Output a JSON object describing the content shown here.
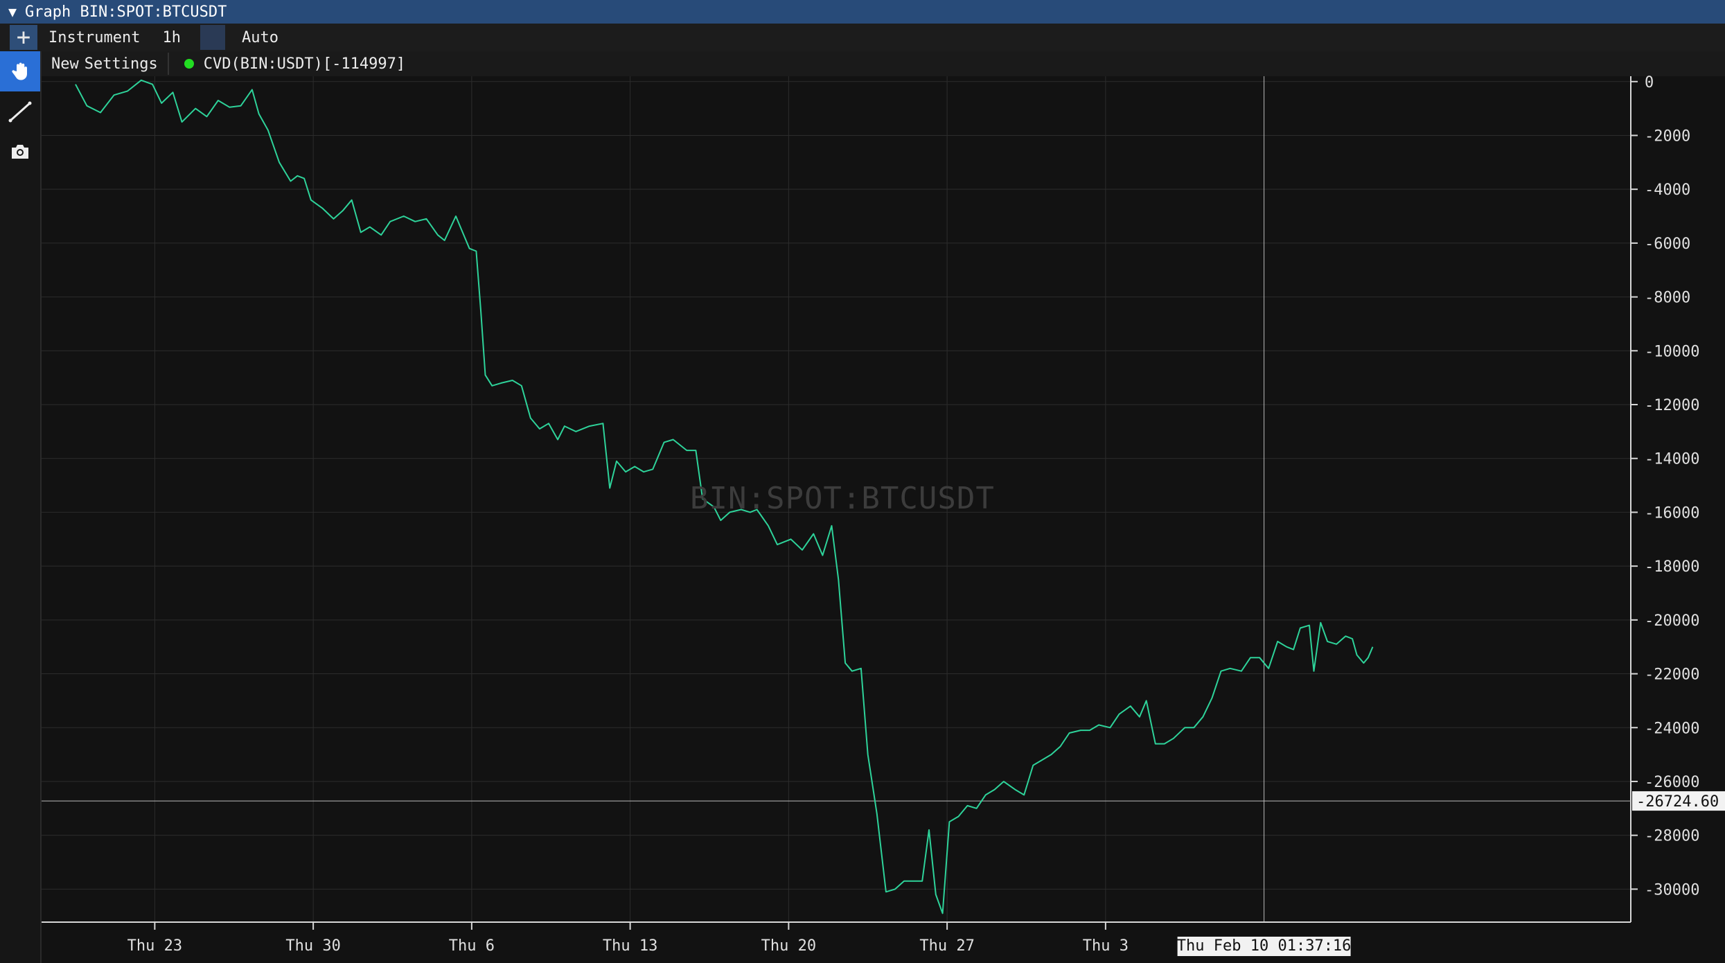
{
  "title_bar": {
    "label": "Graph BIN:SPOT:BTCUSDT",
    "collapse_icon": "triangle-down-icon"
  },
  "toolbar": {
    "add_icon": "plus-icon",
    "instrument_label": "Instrument",
    "timeframe_label": "1h",
    "auto_label": "Auto"
  },
  "subtoolbar": {
    "new_label": "New",
    "settings_label": "Settings",
    "indicator_status_color": "#22dd22",
    "indicator_label": "CVD(BIN:USDT)[-114997]"
  },
  "left_tools": [
    "hand-icon",
    "line-draw-icon",
    "camera-icon"
  ],
  "chart_data": {
    "type": "line",
    "watermark": "BIN:SPOT:BTCUSDT",
    "line_color": "#2ed39a",
    "x_unit": "days after Thu 23",
    "x_range": [
      -5.0,
      65.2
    ],
    "x_ticks": [
      {
        "x": 0,
        "label": "Thu 23"
      },
      {
        "x": 7,
        "label": "Thu 30"
      },
      {
        "x": 14,
        "label": "Thu 6"
      },
      {
        "x": 21,
        "label": "Thu 13"
      },
      {
        "x": 28,
        "label": "Thu 20"
      },
      {
        "x": 35,
        "label": "Thu 27"
      },
      {
        "x": 42,
        "label": "Thu 3"
      }
    ],
    "crosshair": {
      "x": 49.0,
      "x_label": "Thu Feb 10 01:37:16",
      "y": -26724.6,
      "y_label": "-26724.60"
    },
    "ylim": [
      -31200,
      200
    ],
    "y_ticks": [
      0,
      -2000,
      -4000,
      -6000,
      -8000,
      -10000,
      -12000,
      -14000,
      -16000,
      -18000,
      -20000,
      -22000,
      -24000,
      -26000,
      -28000,
      -30000
    ],
    "grid": true,
    "series": [
      {
        "points": [
          [
            -3.5,
            -100
          ],
          [
            -3.0,
            -900
          ],
          [
            -2.4,
            -1150
          ],
          [
            -1.8,
            -500
          ],
          [
            -1.2,
            -350
          ],
          [
            -0.6,
            50
          ],
          [
            -0.1,
            -100
          ],
          [
            0.3,
            -800
          ],
          [
            0.8,
            -400
          ],
          [
            1.2,
            -1500
          ],
          [
            1.8,
            -1000
          ],
          [
            2.3,
            -1300
          ],
          [
            2.8,
            -700
          ],
          [
            3.3,
            -950
          ],
          [
            3.8,
            -900
          ],
          [
            4.3,
            -300
          ],
          [
            4.6,
            -1200
          ],
          [
            5.0,
            -1800
          ],
          [
            5.5,
            -3000
          ],
          [
            6.0,
            -3700
          ],
          [
            6.3,
            -3500
          ],
          [
            6.6,
            -3600
          ],
          [
            6.9,
            -4400
          ],
          [
            7.4,
            -4700
          ],
          [
            7.9,
            -5100
          ],
          [
            8.3,
            -4800
          ],
          [
            8.7,
            -4400
          ],
          [
            9.1,
            -5600
          ],
          [
            9.5,
            -5400
          ],
          [
            10.0,
            -5700
          ],
          [
            10.4,
            -5200
          ],
          [
            11.0,
            -5000
          ],
          [
            11.5,
            -5200
          ],
          [
            12.0,
            -5100
          ],
          [
            12.5,
            -5700
          ],
          [
            12.8,
            -5900
          ],
          [
            13.3,
            -5000
          ],
          [
            13.6,
            -5600
          ],
          [
            13.9,
            -6200
          ],
          [
            14.2,
            -6300
          ],
          [
            14.4,
            -8500
          ],
          [
            14.6,
            -10900
          ],
          [
            14.9,
            -11300
          ],
          [
            15.3,
            -11200
          ],
          [
            15.8,
            -11100
          ],
          [
            16.2,
            -11300
          ],
          [
            16.6,
            -12500
          ],
          [
            17.0,
            -12900
          ],
          [
            17.4,
            -12700
          ],
          [
            17.8,
            -13300
          ],
          [
            18.1,
            -12800
          ],
          [
            18.6,
            -13000
          ],
          [
            19.2,
            -12800
          ],
          [
            19.8,
            -12700
          ],
          [
            20.1,
            -15100
          ],
          [
            20.4,
            -14100
          ],
          [
            20.8,
            -14500
          ],
          [
            21.2,
            -14300
          ],
          [
            21.6,
            -14500
          ],
          [
            22.0,
            -14400
          ],
          [
            22.5,
            -13400
          ],
          [
            22.9,
            -13300
          ],
          [
            23.5,
            -13700
          ],
          [
            23.9,
            -13700
          ],
          [
            24.2,
            -15500
          ],
          [
            24.7,
            -15800
          ],
          [
            25.0,
            -16300
          ],
          [
            25.4,
            -16000
          ],
          [
            25.9,
            -15900
          ],
          [
            26.3,
            -16000
          ],
          [
            26.6,
            -15900
          ],
          [
            27.1,
            -16500
          ],
          [
            27.5,
            -17200
          ],
          [
            28.1,
            -17000
          ],
          [
            28.6,
            -17400
          ],
          [
            29.1,
            -16800
          ],
          [
            29.5,
            -17600
          ],
          [
            29.9,
            -16500
          ],
          [
            30.2,
            -18500
          ],
          [
            30.5,
            -21600
          ],
          [
            30.8,
            -21900
          ],
          [
            31.2,
            -21800
          ],
          [
            31.5,
            -25000
          ],
          [
            31.9,
            -27200
          ],
          [
            32.3,
            -30100
          ],
          [
            32.7,
            -30000
          ],
          [
            33.1,
            -29700
          ],
          [
            33.5,
            -29700
          ],
          [
            33.9,
            -29700
          ],
          [
            34.2,
            -27800
          ],
          [
            34.5,
            -30200
          ],
          [
            34.8,
            -30900
          ],
          [
            35.1,
            -27500
          ],
          [
            35.5,
            -27300
          ],
          [
            35.9,
            -26900
          ],
          [
            36.3,
            -27000
          ],
          [
            36.7,
            -26500
          ],
          [
            37.1,
            -26300
          ],
          [
            37.5,
            -26000
          ],
          [
            38.0,
            -26300
          ],
          [
            38.4,
            -26500
          ],
          [
            38.8,
            -25400
          ],
          [
            39.2,
            -25200
          ],
          [
            39.6,
            -25000
          ],
          [
            40.0,
            -24700
          ],
          [
            40.4,
            -24200
          ],
          [
            40.9,
            -24100
          ],
          [
            41.3,
            -24100
          ],
          [
            41.7,
            -23900
          ],
          [
            42.2,
            -24000
          ],
          [
            42.6,
            -23500
          ],
          [
            43.1,
            -23200
          ],
          [
            43.5,
            -23600
          ],
          [
            43.8,
            -23000
          ],
          [
            44.2,
            -24600
          ],
          [
            44.6,
            -24600
          ],
          [
            45.0,
            -24400
          ],
          [
            45.5,
            -24000
          ],
          [
            45.9,
            -24000
          ],
          [
            46.3,
            -23600
          ],
          [
            46.7,
            -22900
          ],
          [
            47.1,
            -21900
          ],
          [
            47.5,
            -21800
          ],
          [
            48.0,
            -21900
          ],
          [
            48.4,
            -21400
          ],
          [
            48.8,
            -21400
          ],
          [
            49.2,
            -21800
          ],
          [
            49.6,
            -20800
          ],
          [
            50.0,
            -21000
          ],
          [
            50.3,
            -21100
          ],
          [
            50.6,
            -20300
          ],
          [
            51.0,
            -20200
          ],
          [
            51.2,
            -21900
          ],
          [
            51.5,
            -20100
          ],
          [
            51.8,
            -20800
          ],
          [
            52.2,
            -20900
          ],
          [
            52.6,
            -20600
          ],
          [
            52.9,
            -20700
          ],
          [
            53.1,
            -21300
          ],
          [
            53.4,
            -21600
          ],
          [
            53.6,
            -21400
          ],
          [
            53.8,
            -21000
          ]
        ]
      }
    ]
  }
}
